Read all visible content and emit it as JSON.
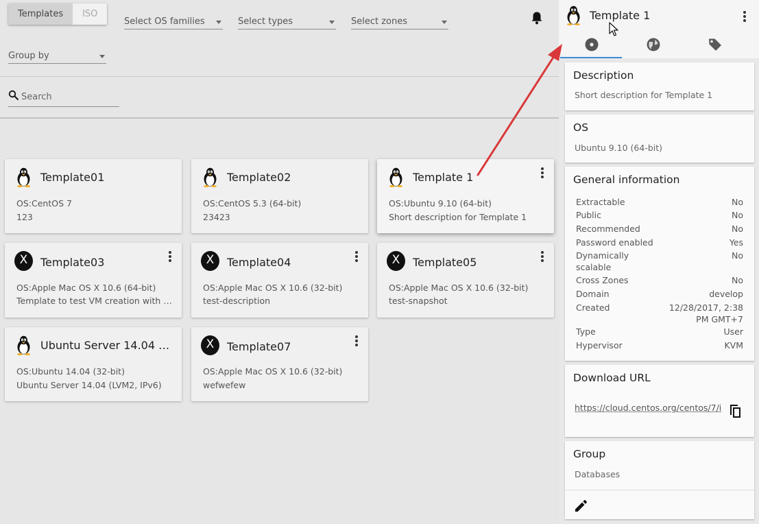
{
  "toolbar": {
    "tabs": [
      {
        "label": "Templates",
        "active": true
      },
      {
        "label": "ISO",
        "active": false
      }
    ],
    "filters": {
      "os_families": "Select OS families",
      "types": "Select types",
      "zones": "Select zones",
      "group_by": "Group by"
    },
    "search_placeholder": "Search"
  },
  "cards": [
    {
      "title": "Template01",
      "icon": "linux-penguin-icon",
      "line1": "OS:CentOS 7",
      "line2": "123",
      "has_menu": false
    },
    {
      "title": "Template02",
      "icon": "linux-penguin-icon",
      "line1": "OS:CentOS 5.3 (64-bit)",
      "line2": "23423",
      "has_menu": false
    },
    {
      "title": "Template 1",
      "icon": "linux-penguin-icon",
      "line1": "OS:Ubuntu 9.10 (64-bit)",
      "line2": "Short description for Template 1",
      "has_menu": true,
      "selected": true
    },
    {
      "title": "Template03",
      "icon": "mac-os-x-icon",
      "line1": "OS:Apple Mac OS X 10.6 (64-bit)",
      "line2": "Template to test VM creation with …",
      "has_menu": true
    },
    {
      "title": "Template04",
      "icon": "mac-os-x-icon",
      "line1": "OS:Apple Mac OS X 10.6 (32-bit)",
      "line2": "test-description",
      "has_menu": true
    },
    {
      "title": "Template05",
      "icon": "mac-os-x-icon",
      "line1": "OS:Apple Mac OS X 10.6 (32-bit)",
      "line2": "test-snapshot",
      "has_menu": true
    },
    {
      "title": "Ubuntu Server 14.04 (…",
      "icon": "linux-penguin-icon",
      "line1": "OS:Ubuntu 14.04 (32-bit)",
      "line2": "Ubuntu Server 14.04 (LVM2, IPv6)",
      "has_menu": false
    },
    {
      "title": "Template07",
      "icon": "mac-os-x-icon",
      "line1": "OS:Apple Mac OS X 10.6 (32-bit)",
      "line2": "wefwefew",
      "has_menu": true
    }
  ],
  "mac_icon_glyph": "X",
  "sidebar": {
    "title": "Template 1",
    "tabs": [
      {
        "icon": "disc-icon",
        "active": true
      },
      {
        "icon": "globe-icon",
        "active": false
      },
      {
        "icon": "tag-icon",
        "active": false
      }
    ],
    "description": {
      "title": "Description",
      "text": "Short description for Template 1"
    },
    "os": {
      "title": "OS",
      "text": "Ubuntu 9.10 (64-bit)"
    },
    "general": {
      "title": "General information",
      "rows": [
        {
          "key": "Extractable",
          "value": "No"
        },
        {
          "key": "Public",
          "value": "No"
        },
        {
          "key": "Recommended",
          "value": "No"
        },
        {
          "key": "Password enabled",
          "value": "Yes"
        },
        {
          "key": "Dynamically scalable",
          "value": "No"
        },
        {
          "key": "Cross Zones",
          "value": "No"
        },
        {
          "key": "Domain",
          "value": "develop"
        },
        {
          "key": "Created",
          "value": "12/28/2017, 2:38 PM GMT+7"
        },
        {
          "key": "Type",
          "value": "User"
        },
        {
          "key": "Hypervisor",
          "value": "KVM"
        }
      ]
    },
    "download": {
      "title": "Download URL",
      "url": "https://cloud.centos.org/centos/7/i"
    },
    "group": {
      "title": "Group",
      "text": "Databases"
    }
  },
  "colors": {
    "accent": "#3d8bd6",
    "annotation_arrow": "#d9383a"
  }
}
